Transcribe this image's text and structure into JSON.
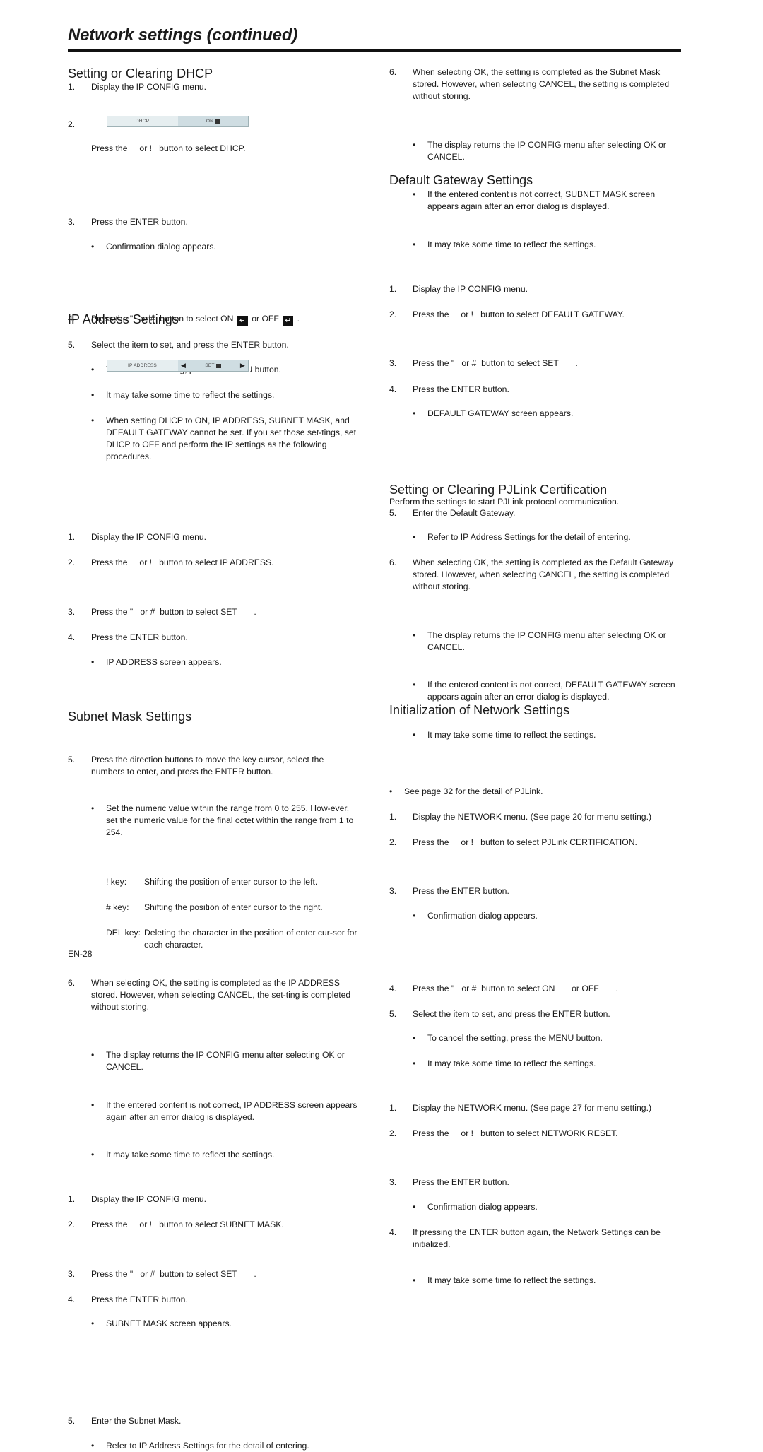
{
  "page": {
    "title": "Network settings (continued)",
    "page_number": "EN-28"
  },
  "dhcp": {
    "heading": "Setting or Clearing DHCP",
    "s1_num": "1.",
    "s1": "Display the IP CONFIG menu.",
    "s2_num": "2.",
    "s2": "Press the     or !   button to select DHCP.",
    "menu_label": "DHCP",
    "menu_value": "ON",
    "s3_num": "3.",
    "s3": "Press the ENTER button.",
    "s3_b1": "Confirmation dialog appears.",
    "s4_num": "4.",
    "s4_a": "Press the \"   or #  button to select ON",
    "s4_b": "or OFF",
    "s4_c": ".",
    "s5_num": "5.",
    "s5": "Select the item to set, and press the ENTER button.",
    "s5_b1": "To cancel the setting, press the MENU button.",
    "s5_b2": "It may take some time to reflect the settings.",
    "s5_b3": "When setting DHCP to ON, IP ADDRESS, SUBNET MASK, and DEFAULT GATEWAY cannot be set. If you set those set-tings, set DHCP to OFF and perform the IP settings as the following procedures."
  },
  "ip": {
    "heading": "IP Address Settings",
    "s1_num": "1.",
    "s1": "Display the IP CONFIG menu.",
    "s2_num": "2.",
    "s2": "Press the     or !   button to select IP ADDRESS.",
    "menu_label": "IP ADDRESS",
    "menu_value": "SET",
    "s3_num": "3.",
    "s3": "Press the \"   or #  button to select SET       .",
    "s4_num": "4.",
    "s4": "Press the ENTER button.",
    "s4_b1": "IP ADDRESS screen appears.",
    "s5_num": "5.",
    "s5": "Press the direction buttons to move the key cursor, select the numbers to enter, and press the ENTER button.",
    "s5_b1": "Set the numeric value within the range from 0 to 255. How-ever, set the numeric value for the final octet within the range from 1 to 254.",
    "keys": [
      {
        "key": "!  key:",
        "desc": "Shifting the position of enter cursor to the left."
      },
      {
        "key": "#  key:",
        "desc": "Shifting the position of enter cursor to the right."
      },
      {
        "key": "DEL key:",
        "desc": "Deleting the character in the position of enter cur-sor for each character."
      }
    ],
    "s6_num": "6.",
    "s6": "When selecting OK, the setting is completed as the IP ADDRESS stored. However, when selecting CANCEL, the set-ting is completed without storing.",
    "s6_b1": "The display returns the IP CONFIG menu after selecting OK or CANCEL.",
    "s6_b2": "If the entered content is not correct, IP ADDRESS screen appears again after an error dialog is displayed.",
    "s6_b3": "It may take some time to reflect the settings."
  },
  "subnet": {
    "heading": "Subnet Mask Settings",
    "s1_num": "1.",
    "s1": "Display the IP CONFIG menu.",
    "s2_num": "2.",
    "s2": "Press the     or !   button to select SUBNET MASK.",
    "s3_num": "3.",
    "s3": "Press the \"   or #  button to select SET       .",
    "s4_num": "4.",
    "s4": "Press the ENTER button.",
    "s4_b1": "SUBNET MASK screen appears.",
    "s5_num": "5.",
    "s5": "Enter the Subnet Mask.",
    "s5_b1": "Refer to IP Address Settings for the detail of entering.",
    "s6_num": "6.",
    "s6": "When selecting OK, the setting is completed as the Subnet Mask stored. However, when selecting CANCEL, the setting is completed without storing.",
    "s6_b1": "The display returns the IP CONFIG menu after selecting OK or CANCEL.",
    "s6_b2": "If the entered content is not correct, SUBNET MASK screen appears again after an error dialog is displayed.",
    "s6_b3": "It may take some time to reflect the settings."
  },
  "gateway": {
    "heading": "Default Gateway Settings",
    "s1_num": "1.",
    "s1": "Display the IP CONFIG menu.",
    "s2_num": "2.",
    "s2": "Press the     or !   button to select DEFAULT GATEWAY.",
    "s3_num": "3.",
    "s3": "Press the \"   or #  button to select SET       .",
    "s4_num": "4.",
    "s4": "Press the ENTER button.",
    "s4_b1": "DEFAULT GATEWAY screen appears.",
    "s5_num": "5.",
    "s5": "Enter the Default Gateway.",
    "s5_b1": "Refer to IP Address Settings for the detail of entering.",
    "s6_num": "6.",
    "s6": "When selecting OK, the setting is completed as the Default Gateway stored. However, when selecting CANCEL, the setting is completed without storing.",
    "s6_b1": "The display returns the IP CONFIG menu after selecting OK or CANCEL.",
    "s6_b2": "If the entered content is not correct, DEFAULT GATEWAY screen appears again after an error dialog is displayed.",
    "s6_b3": "It may take some time to reflect the settings."
  },
  "pjlink": {
    "heading": "Setting or Clearing PJLink Certification",
    "intro": "Perform the settings to start PJLink protocol communication.",
    "intro_b1": "See page 32 for the detail of PJLink.",
    "s1_num": "1.",
    "s1": "Display the NETWORK menu. (See page 20 for menu setting.)",
    "s2_num": "2.",
    "s2": "Press the     or !   button to select PJLink CERTIFICATION.",
    "s3_num": "3.",
    "s3": "Press the ENTER button.",
    "s3_b1": "Confirmation dialog appears.",
    "s4_num": "4.",
    "s4": "Press the \"   or #  button to select ON       or OFF       .",
    "s5_num": "5.",
    "s5": "Select the item to set, and press the ENTER button.",
    "s5_b1": "To cancel the setting, press the MENU button.",
    "s5_b2": "It may take some time to reflect the settings."
  },
  "init": {
    "heading": "Initialization of Network Settings",
    "s1_num": "1.",
    "s1": "Display the NETWORK menu. (See page 27 for menu setting.)",
    "s2_num": "2.",
    "s2": "Press the     or !   button to select NETWORK RESET.",
    "s3_num": "3.",
    "s3": "Press the ENTER button.",
    "s3_b1": "Confirmation dialog appears.",
    "s4_num": "4.",
    "s4": "If pressing the ENTER button again, the Network Settings can be initialized.",
    "s4_b1": "It may take some time to reflect the settings."
  },
  "glyphs": {
    "bullet": "•",
    "enter": "↵",
    "left": "◀",
    "right": "▶"
  }
}
